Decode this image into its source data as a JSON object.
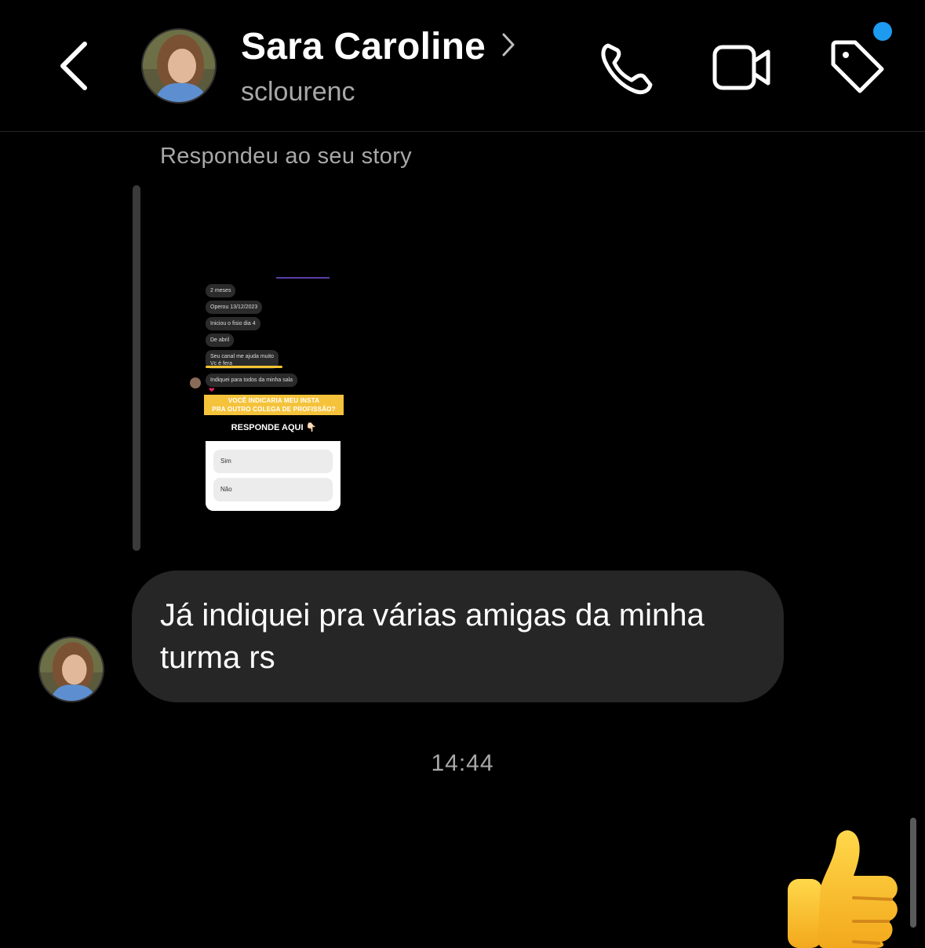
{
  "header": {
    "contact_name": "Sara Caroline",
    "username": "sclourenc",
    "icons": [
      "back-icon",
      "chevron-right-icon",
      "phone-icon",
      "video-camera-icon",
      "tag-icon"
    ],
    "notification_dot_color": "#1d9bf0"
  },
  "story_reply": {
    "caption": "Respondeu ao seu story",
    "thumbnail": {
      "bubbles": [
        "2 meses",
        "Operou 13/12/2023",
        "Iniciou o fisio dia 4",
        "De abril",
        "Seu canal me ajuda muito",
        "Vc é fera",
        "Indiquei para todos da minha sala"
      ],
      "question_line1": "VOCÊ INDICARIA MEU INSTA",
      "question_line2": "PRA OUTRO COLEGA DE PROFISSÃO?",
      "prompt": "RESPONDE AQUI 👇🏻",
      "options": [
        "Sim",
        "Não"
      ]
    }
  },
  "message": {
    "text": "Já indiquei pra várias amigas da minha turma rs",
    "time": "14:44"
  },
  "reaction": {
    "icon": "thumbs-up-icon"
  }
}
